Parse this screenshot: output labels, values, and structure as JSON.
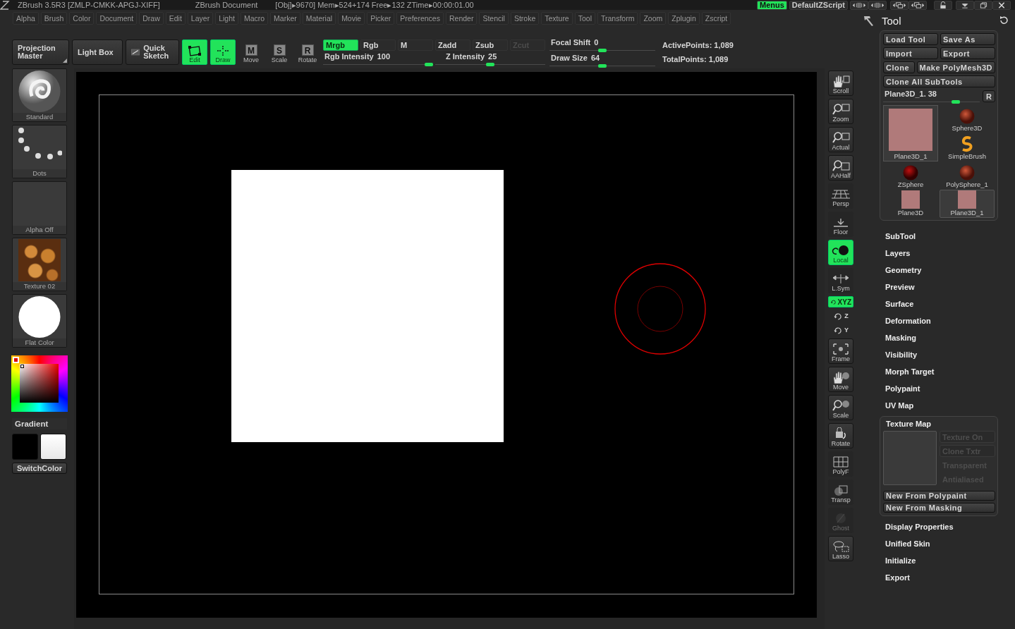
{
  "title_bar": {
    "texts": [
      "ZBrush 3.5R3 [ZMLP-CMKK-APGJ-XIFF]",
      "ZBrush Document",
      "[Obj]▸9670] Mem▸524+174 Free▸132 ZTime▸00:00:01.00"
    ],
    "buttons": [
      {
        "label": "Menus",
        "on": true
      },
      {
        "label": "DefaultZScript",
        "on": false
      }
    ]
  },
  "menu_bar": [
    "Alpha",
    "Brush",
    "Color",
    "Document",
    "Draw",
    "Edit",
    "Layer",
    "Light",
    "Macro",
    "Marker",
    "Material",
    "Movie",
    "Picker",
    "Preferences",
    "Render",
    "Stencil",
    "Stroke",
    "Texture",
    "Tool",
    "Transform",
    "Zoom",
    "Zplugin",
    "Zscript"
  ],
  "toolbar": {
    "buttons": [
      "Projection Master",
      "Light Box",
      "Quick Sketch"
    ],
    "modes": [
      {
        "label": "Edit",
        "on": true
      },
      {
        "label": "Draw",
        "on": true
      },
      {
        "label": "Move",
        "glyph": "M",
        "on": false
      },
      {
        "label": "Scale",
        "glyph": "S",
        "on": false
      },
      {
        "label": "Rotate",
        "glyph": "R",
        "on": false
      }
    ],
    "channels": [
      {
        "label": "Mrgb",
        "on": true,
        "disabled": false
      },
      {
        "label": "Rgb",
        "on": false,
        "disabled": false
      },
      {
        "label": "M",
        "on": false,
        "disabled": false
      },
      {
        "label": "Zadd",
        "on": false,
        "disabled": false
      },
      {
        "label": "Zsub",
        "on": false,
        "disabled": false
      },
      {
        "label": "Zcut",
        "on": false,
        "disabled": true
      }
    ],
    "sliders": [
      {
        "label": "Rgb Intensity",
        "value": "100",
        "level": 0.96
      },
      {
        "label": "Z Intensity",
        "value": "25",
        "level": 0.5
      },
      {
        "label": "Focal Shift",
        "value": "0",
        "level": 0.5
      },
      {
        "label": "Draw Size",
        "value": "64",
        "level": 0.5
      }
    ],
    "stats": [
      "ActivePoints: 1,089",
      "TotalPoints: 1,089"
    ]
  },
  "left_shelf": {
    "items": [
      {
        "label": "Standard",
        "kind": "brush"
      },
      {
        "label": "Dots",
        "kind": "stroke"
      },
      {
        "label": "Alpha  Off",
        "kind": "alpha"
      },
      {
        "label": "Texture  02",
        "kind": "texture"
      },
      {
        "label": "Flat  Color",
        "kind": "material"
      }
    ],
    "gradient": "Gradient",
    "switch_color": "SwitchColor"
  },
  "right_shelf": [
    {
      "label": "Scroll",
      "kind": "button",
      "on": false,
      "disabled": false
    },
    {
      "label": "Zoom",
      "kind": "button",
      "on": false,
      "disabled": false
    },
    {
      "label": "Actual",
      "kind": "button",
      "on": false,
      "disabled": false
    },
    {
      "label": "AAHalf",
      "kind": "button",
      "on": false,
      "disabled": false
    },
    {
      "label": "Persp",
      "kind": "toggle",
      "on": false,
      "disabled": false
    },
    {
      "label": "Floor",
      "kind": "toggle",
      "on": false,
      "disabled": false
    },
    {
      "label": "Local",
      "kind": "toggle",
      "on": true,
      "disabled": false
    },
    {
      "label": "L.Sym",
      "kind": "toggle",
      "on": false,
      "disabled": false
    },
    {
      "label": "XYZ",
      "kind": "axis",
      "on": true,
      "disabled": false
    },
    {
      "label": "Z",
      "kind": "axis",
      "on": false,
      "disabled": false
    },
    {
      "label": "Y",
      "kind": "axis",
      "on": false,
      "disabled": false
    },
    {
      "label": "Frame",
      "kind": "button",
      "on": false,
      "disabled": false
    },
    {
      "label": "Move",
      "kind": "button",
      "on": false,
      "disabled": false
    },
    {
      "label": "Scale",
      "kind": "button",
      "on": false,
      "disabled": false
    },
    {
      "label": "Rotate",
      "kind": "button",
      "on": false,
      "disabled": false
    },
    {
      "label": "PolyF",
      "kind": "toggle",
      "on": false,
      "disabled": false
    },
    {
      "label": "Transp",
      "kind": "toggle",
      "on": false,
      "disabled": false
    },
    {
      "label": "Ghost",
      "kind": "toggle",
      "on": false,
      "disabled": true
    },
    {
      "label": "Lasso",
      "kind": "button",
      "on": false,
      "disabled": false
    }
  ],
  "tool_panel": {
    "title": "Tool",
    "button_rows": [
      [
        "Load Tool",
        "Save As"
      ],
      [
        "Import",
        "Export"
      ],
      [
        "Clone",
        "Make PolyMesh3D"
      ],
      [
        "Clone All SubTools"
      ]
    ],
    "slider": {
      "label": "Plane3D_1. 38",
      "level": 0.75
    },
    "reset_button": "R",
    "current_tool": {
      "label": "Plane3D_1"
    },
    "tools": [
      {
        "label": "Sphere3D",
        "kind": "sphere",
        "selected": false
      },
      {
        "label": "SimpleBrush",
        "kind": "brush",
        "selected": false
      },
      {
        "label": "ZSphere",
        "kind": "zsphere",
        "selected": false
      },
      {
        "label": "PolySphere_1",
        "kind": "sphere",
        "selected": false
      },
      {
        "label": "Plane3D",
        "kind": "plane",
        "selected": false
      },
      {
        "label": "Plane3D_1",
        "kind": "plane",
        "selected": true
      }
    ],
    "sections": [
      {
        "label": "SubTool",
        "expanded": false
      },
      {
        "label": "Layers",
        "expanded": false
      },
      {
        "label": "Geometry",
        "expanded": false
      },
      {
        "label": "Preview",
        "expanded": false
      },
      {
        "label": "Surface",
        "expanded": false
      },
      {
        "label": "Deformation",
        "expanded": false
      },
      {
        "label": "Masking",
        "expanded": false
      },
      {
        "label": "Visibility",
        "expanded": false
      },
      {
        "label": "Morph Target",
        "expanded": false
      },
      {
        "label": "Polypaint",
        "expanded": false
      },
      {
        "label": "UV Map",
        "expanded": false
      },
      {
        "label": "Texture Map",
        "expanded": true
      },
      {
        "label": "Display Properties",
        "expanded": false
      },
      {
        "label": "Unified Skin",
        "expanded": false
      },
      {
        "label": "Initialize",
        "expanded": false
      },
      {
        "label": "Export",
        "expanded": false
      }
    ],
    "texture_map": {
      "options": [
        {
          "label": "Texture On",
          "kind": "button",
          "disabled": true
        },
        {
          "label": "Clone Txtr",
          "kind": "button",
          "disabled": true
        },
        {
          "label": "Transparent",
          "kind": "switch",
          "disabled": true
        },
        {
          "label": "Antialiased",
          "kind": "switch",
          "disabled": true
        }
      ],
      "buttons": [
        "New From Polypaint",
        "New From Masking"
      ]
    }
  }
}
